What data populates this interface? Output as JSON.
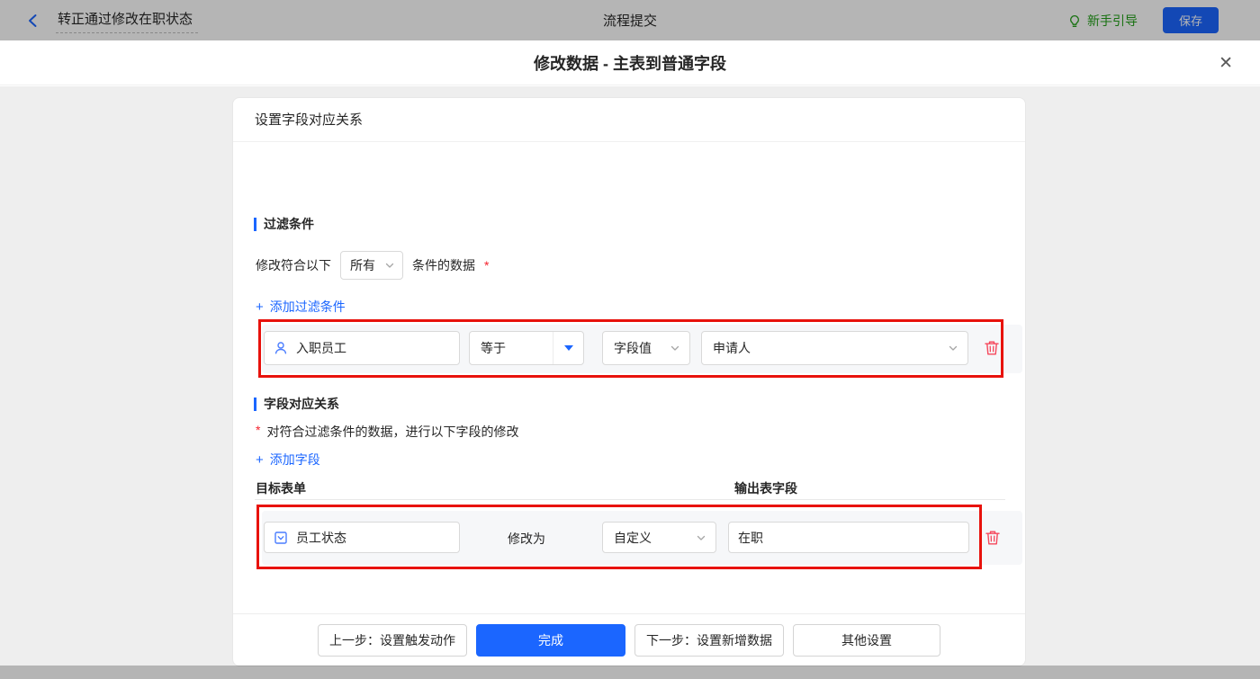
{
  "colors": {
    "accent": "#1b66ff",
    "green": "#23a018",
    "danger": "#f5222d",
    "trash": "#f5475b",
    "annotation": "#e8120c"
  },
  "topbar": {
    "flow_name": "转正通过修改在职状态",
    "center_title": "流程提交",
    "guide_label": "新手引导",
    "save_label": "保存"
  },
  "modal": {
    "title": "修改数据 - 主表到普通字段",
    "close_glyph": "✕"
  },
  "card": {
    "header": "设置字段对应关系",
    "filter": {
      "section_title": "过滤条件",
      "match_prefix": "修改符合以下",
      "match_mode": "所有",
      "match_suffix": "条件的数据",
      "required_mark": "*",
      "plus": "+",
      "add_label": "添加过滤条件",
      "condition": {
        "field": "入职员工",
        "operator": "等于",
        "value_type": "字段值",
        "value": "申请人"
      }
    },
    "mapping": {
      "section_title": "字段对应关系",
      "required_mark": "*",
      "description": "对符合过滤条件的数据，进行以下字段的修改",
      "plus": "+",
      "add_label": "添加字段",
      "columns": {
        "target": "目标表单",
        "output": "输出表字段"
      },
      "row": {
        "field": "员工状态",
        "modify_label": "修改为",
        "mode": "自定义",
        "value": "在职"
      }
    }
  },
  "footer": {
    "prev": "上一步：设置触发动作",
    "done": "完成",
    "next": "下一步：设置新增数据",
    "other": "其他设置"
  }
}
